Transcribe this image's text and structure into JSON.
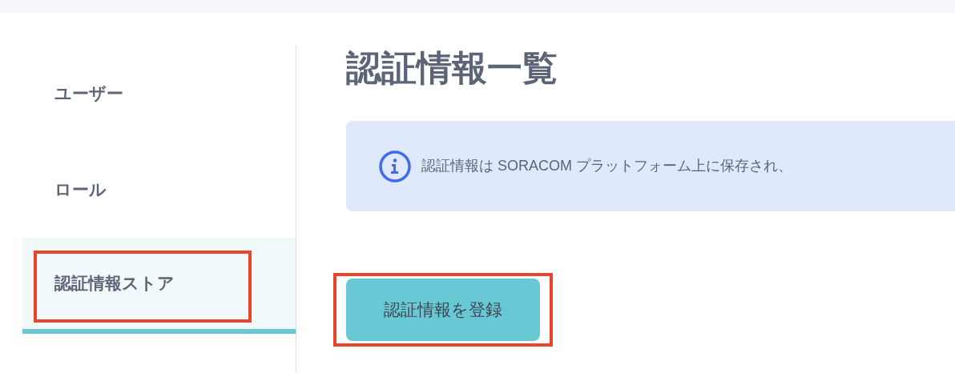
{
  "sidebar": {
    "items": [
      {
        "label": "ユーザー",
        "selected": false,
        "highlighted": false
      },
      {
        "label": "ロール",
        "selected": false,
        "highlighted": false
      },
      {
        "label": "認証情報ストア",
        "selected": true,
        "highlighted": true
      }
    ]
  },
  "main": {
    "title": "認証情報一覧",
    "notice": "認証情報は SORACOM プラットフォーム上に保存され、",
    "button": {
      "label": "認証情報を登録",
      "highlighted": true
    }
  }
}
